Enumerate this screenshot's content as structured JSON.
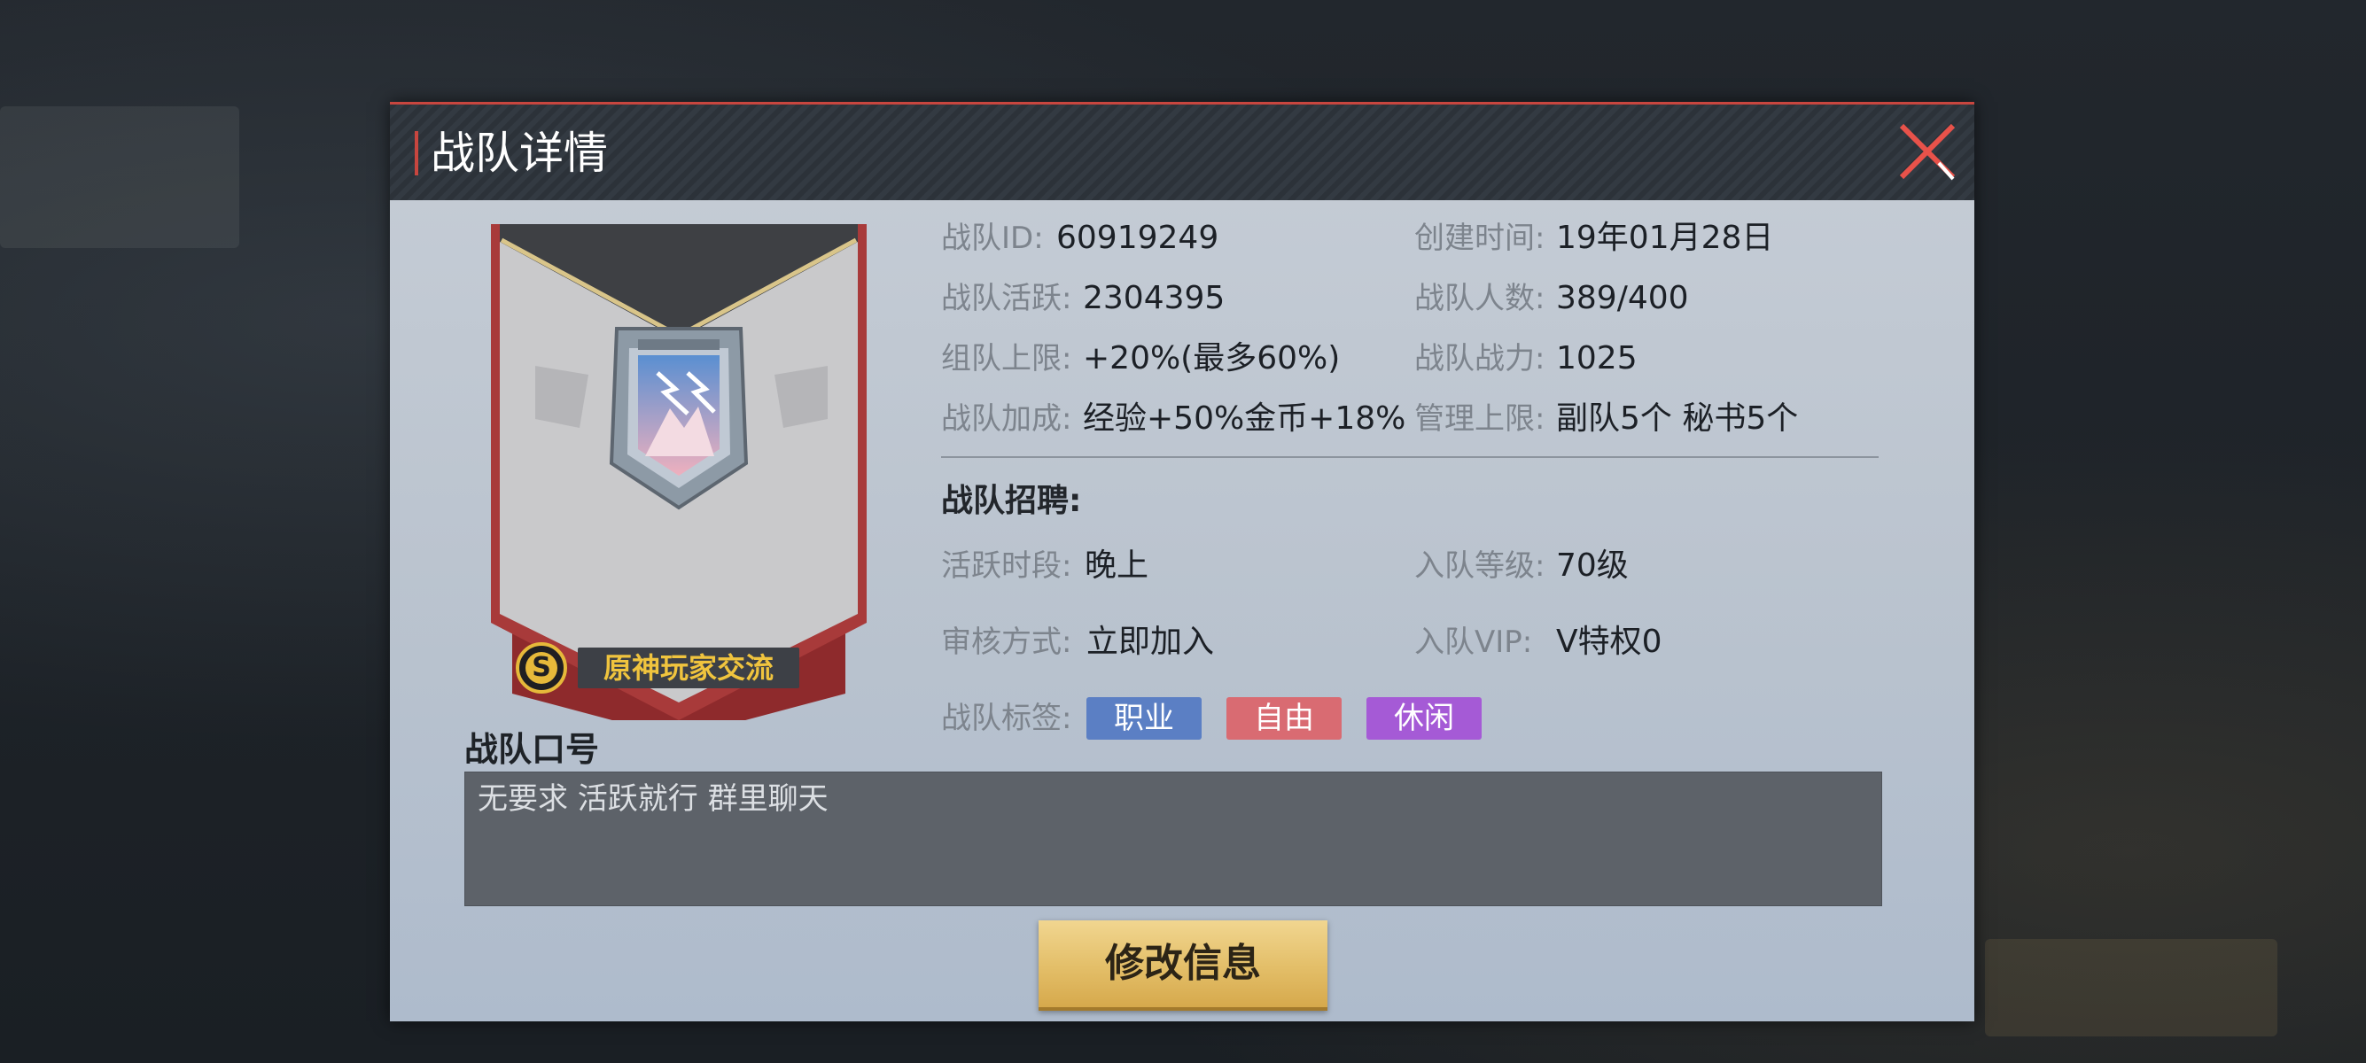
{
  "dialog": {
    "title": "战队详情"
  },
  "team_info": {
    "id_label": "战队ID:",
    "id_value": "60919249",
    "created_label": "创建时间:",
    "created_value": "19年01月28日",
    "activity_label": "战队活跃:",
    "activity_value": "2304395",
    "members_label": "战队人数:",
    "members_value": "389/400",
    "group_limit_label": "组队上限:",
    "group_limit_value": "+20%(最多60%)",
    "power_label": "战队战力:",
    "power_value": "1025",
    "bonus_label": "战队加成:",
    "bonus_value": "经验+50%金币+18%",
    "mgmt_label": "管理上限:",
    "mgmt_value": "副队5个 秘书5个"
  },
  "banner": {
    "badge_letter": "S",
    "team_name": "原神玩家交流"
  },
  "recruit": {
    "title": "战队招聘:",
    "active_time_label": "活跃时段:",
    "active_time_value": "晚上",
    "join_level_label": "入队等级:",
    "join_level_value": "70级",
    "review_label": "审核方式:",
    "review_value": "立即加入",
    "vip_label": "入队VIP:",
    "vip_value": "V特权0",
    "tags_label": "战队标签:",
    "tags": [
      "职业",
      "自由",
      "休闲"
    ]
  },
  "slogan": {
    "label": "战队口号",
    "text": "无要求 活跃就行 群里聊天"
  },
  "actions": {
    "edit_label": "修改信息"
  },
  "colors": {
    "accent_red": "#c8463f",
    "tag_blue": "#5b7fc4",
    "tag_red": "#d96b72",
    "tag_purple": "#a55ad6",
    "button_gold": "#e3be68"
  }
}
